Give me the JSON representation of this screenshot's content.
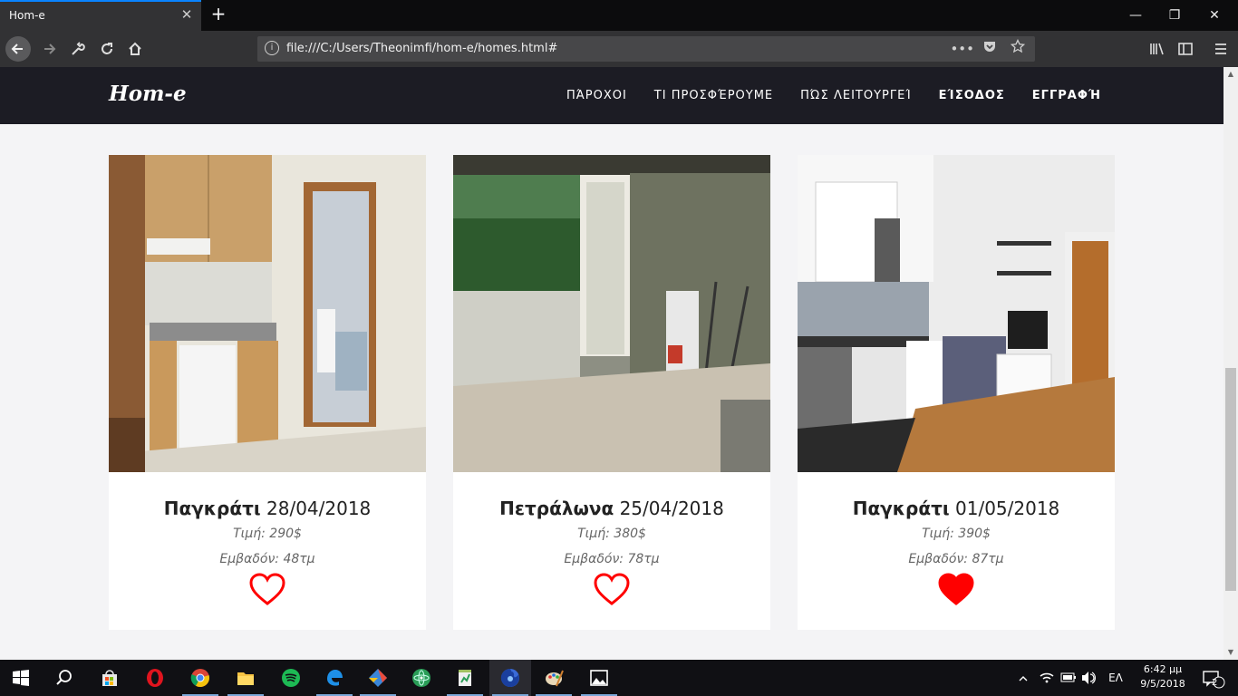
{
  "browser": {
    "tab_title": "Hom-e",
    "tab_close": "✕",
    "new_tab": "+",
    "url": "file:///C:/Users/Theonimfi/hom-e/homes.html#",
    "url_more": "•••",
    "window_minimize": "—",
    "window_restore": "❐",
    "window_close": "✕"
  },
  "site": {
    "brand": "Hom-e",
    "nav": [
      {
        "label": "ΠΆΡΟΧΟΙ"
      },
      {
        "label": "ΤΙ ΠΡΟΣΦΈΡΟΥΜΕ"
      },
      {
        "label": "ΠΏΣ ΛΕΙΤΟΥΡΓΕΊ"
      },
      {
        "label": "ΕΊΣΟΔΟΣ"
      },
      {
        "label": "ΕΓΓΡΑΦΉ"
      }
    ]
  },
  "listings": [
    {
      "area": "Παγκράτι",
      "date": "28/04/2018",
      "price": "Τιμή: 290$",
      "size": "Εμβαδόν: 48τμ",
      "favorite": false
    },
    {
      "area": "Πετράλωνα",
      "date": "25/04/2018",
      "price": "Τιμή: 380$",
      "size": "Εμβαδόν: 78τμ",
      "favorite": false
    },
    {
      "area": "Παγκράτι",
      "date": "01/05/2018",
      "price": "Τιμή: 390$",
      "size": "Εμβαδόν: 87τμ",
      "favorite": true
    }
  ],
  "colors": {
    "heart": "#ff0000",
    "site_header": "#1c1c24",
    "accent": "#0a84ff"
  },
  "taskbar": {
    "language": "ΕΛ",
    "time": "6:42 μμ",
    "date": "9/5/2018",
    "notifications": "2",
    "apps": [
      "windows-start",
      "search",
      "store",
      "opera",
      "chrome",
      "file-explorer",
      "spotify",
      "edge",
      "git-extensions",
      "atom",
      "notepad",
      "firefox",
      "paint",
      "photos"
    ]
  }
}
